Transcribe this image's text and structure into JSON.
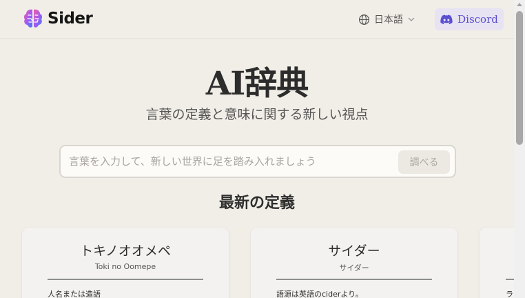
{
  "header": {
    "logo_text": "Sider",
    "language": "日本語",
    "discord_label": "Discord"
  },
  "hero": {
    "title": "AI辞典",
    "subtitle": "言葉の定義と意味に関する新しい視点"
  },
  "search": {
    "placeholder": "言葉を入力して、新しい世界に足を踏み入れましょう",
    "value": "",
    "button_label": "調べる"
  },
  "latest": {
    "title": "最新の定義",
    "cards": [
      {
        "title": "トキノオオメペ",
        "reading": "Toki no Oomepe",
        "desc": "人名または造語"
      },
      {
        "title": "サイダー",
        "reading": "サイダー",
        "desc": "語源は英語のciderより。"
      },
      {
        "title": "",
        "reading": "",
        "desc": "ラ"
      }
    ]
  },
  "colors": {
    "background": "#f1eee7",
    "discord_accent": "#5a4fcf",
    "discord_bg": "#e7e3f2"
  }
}
